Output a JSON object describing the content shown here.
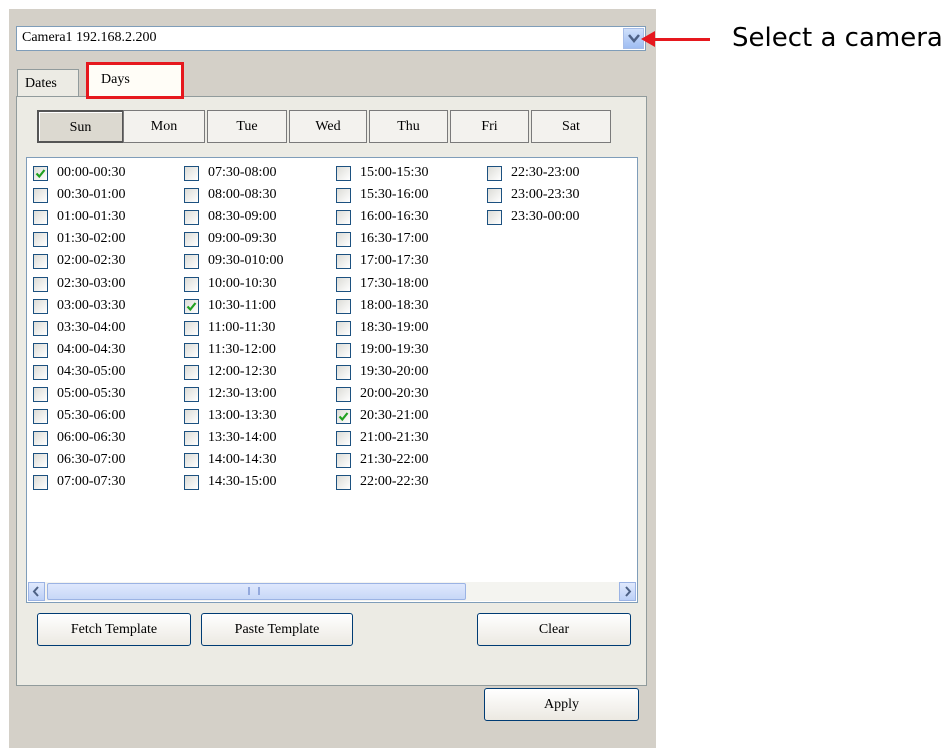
{
  "camera_select": {
    "value": "Camera1 192.168.2.200",
    "arrow_icon": "chevron-down-icon"
  },
  "tabs": [
    {
      "label": "Dates",
      "active": false
    },
    {
      "label": "Days",
      "active": true
    }
  ],
  "days": [
    {
      "label": "Sun",
      "active": true
    },
    {
      "label": "Mon",
      "active": false
    },
    {
      "label": "Tue",
      "active": false
    },
    {
      "label": "Wed",
      "active": false
    },
    {
      "label": "Thu",
      "active": false
    },
    {
      "label": "Fri",
      "active": false
    },
    {
      "label": "Sat",
      "active": false
    }
  ],
  "time_slots": [
    {
      "label": "00:00-00:30",
      "checked": true
    },
    {
      "label": "00:30-01:00",
      "checked": false
    },
    {
      "label": "01:00-01:30",
      "checked": false
    },
    {
      "label": "01:30-02:00",
      "checked": false
    },
    {
      "label": "02:00-02:30",
      "checked": false
    },
    {
      "label": "02:30-03:00",
      "checked": false
    },
    {
      "label": "03:00-03:30",
      "checked": false
    },
    {
      "label": "03:30-04:00",
      "checked": false
    },
    {
      "label": "04:00-04:30",
      "checked": false
    },
    {
      "label": "04:30-05:00",
      "checked": false
    },
    {
      "label": "05:00-05:30",
      "checked": false
    },
    {
      "label": "05:30-06:00",
      "checked": false
    },
    {
      "label": "06:00-06:30",
      "checked": false
    },
    {
      "label": "06:30-07:00",
      "checked": false
    },
    {
      "label": "07:00-07:30",
      "checked": false
    },
    {
      "label": "07:30-08:00",
      "checked": false
    },
    {
      "label": "08:00-08:30",
      "checked": false
    },
    {
      "label": "08:30-09:00",
      "checked": false
    },
    {
      "label": "09:00-09:30",
      "checked": false
    },
    {
      "label": "09:30-010:00",
      "checked": false
    },
    {
      "label": "10:00-10:30",
      "checked": false
    },
    {
      "label": "10:30-11:00",
      "checked": true
    },
    {
      "label": "11:00-11:30",
      "checked": false
    },
    {
      "label": "11:30-12:00",
      "checked": false
    },
    {
      "label": "12:00-12:30",
      "checked": false
    },
    {
      "label": "12:30-13:00",
      "checked": false
    },
    {
      "label": "13:00-13:30",
      "checked": false
    },
    {
      "label": "13:30-14:00",
      "checked": false
    },
    {
      "label": "14:00-14:30",
      "checked": false
    },
    {
      "label": "14:30-15:00",
      "checked": false
    },
    {
      "label": "15:00-15:30",
      "checked": false
    },
    {
      "label": "15:30-16:00",
      "checked": false
    },
    {
      "label": "16:00-16:30",
      "checked": false
    },
    {
      "label": "16:30-17:00",
      "checked": false
    },
    {
      "label": "17:00-17:30",
      "checked": false
    },
    {
      "label": "17:30-18:00",
      "checked": false
    },
    {
      "label": "18:00-18:30",
      "checked": false
    },
    {
      "label": "18:30-19:00",
      "checked": false
    },
    {
      "label": "19:00-19:30",
      "checked": false
    },
    {
      "label": "19:30-20:00",
      "checked": false
    },
    {
      "label": "20:00-20:30",
      "checked": false
    },
    {
      "label": "20:30-21:00",
      "checked": true
    },
    {
      "label": "21:00-21:30",
      "checked": false
    },
    {
      "label": "21:30-22:00",
      "checked": false
    },
    {
      "label": "22:00-22:30",
      "checked": false
    },
    {
      "label": "22:30-23:00",
      "checked": false
    },
    {
      "label": "23:00-23:30",
      "checked": false
    },
    {
      "label": "23:30-00:00",
      "checked": false
    }
  ],
  "buttons": {
    "fetch_template": "Fetch Template",
    "paste_template": "Paste Template",
    "clear": "Clear",
    "apply": "Apply"
  },
  "annotation": {
    "text": "Select a camera",
    "color": "#e6181e"
  }
}
